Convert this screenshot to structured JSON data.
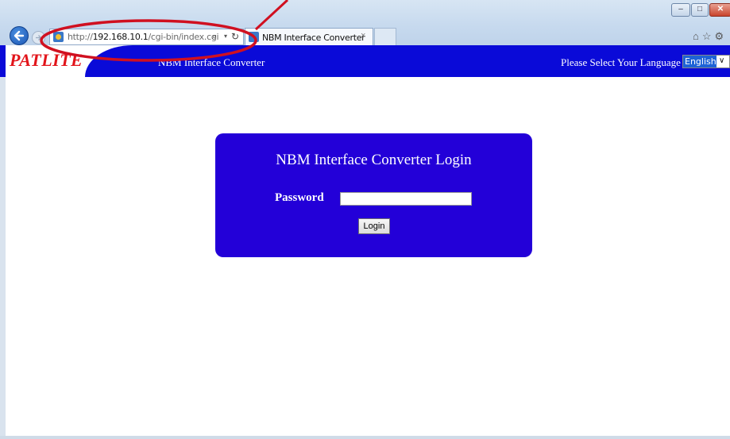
{
  "browser": {
    "url_prefix": "http://",
    "url_host": "192.168.10.1",
    "url_path": "/cgi-bin/index.cgi",
    "tab_title": "NBM Interface Converter",
    "tab_close": "×"
  },
  "header": {
    "logo": "PATLITE",
    "title": "NBM Interface Converter",
    "language_label": "Please Select Your Language :",
    "language_selected": "English"
  },
  "login": {
    "title": "NBM Interface Converter Login",
    "password_label": "Password",
    "password_value": "",
    "button_label": "Login"
  },
  "colors": {
    "header_bg": "#0a0ad8",
    "panel_bg": "#2300d8",
    "logo_red": "#e2141a",
    "annotation_red": "#d01020"
  },
  "icons": [
    "back-icon",
    "forward-icon",
    "site-icon",
    "search-icon",
    "refresh-icon",
    "home-icon",
    "star-icon",
    "gear-icon"
  ]
}
